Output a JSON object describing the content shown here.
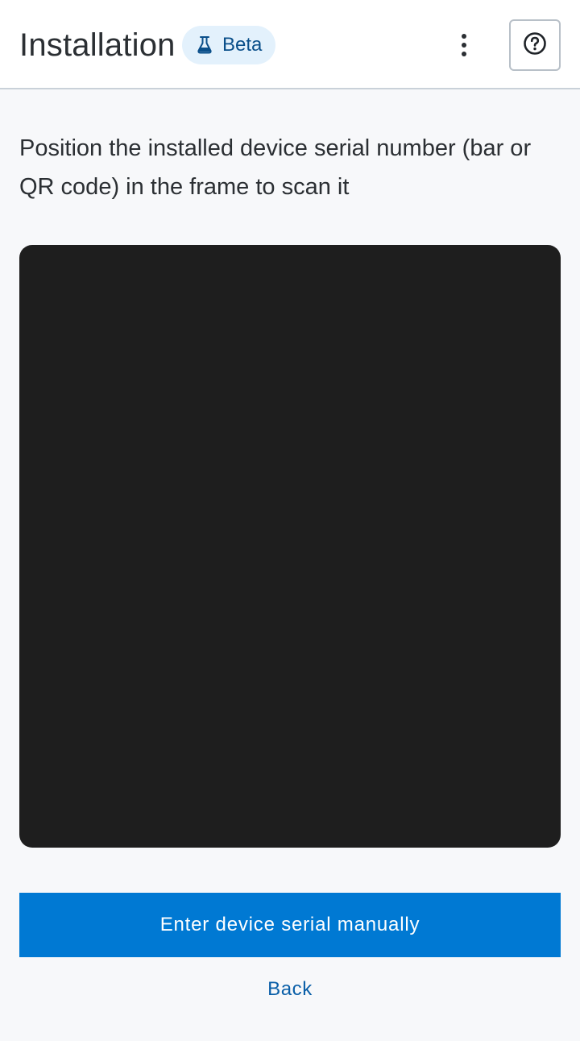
{
  "header": {
    "title": "Installation",
    "badge": {
      "label": "Beta",
      "icon": "flask-icon"
    },
    "more_icon": "vertical-dots-icon",
    "help_icon": "question-circle-icon"
  },
  "main": {
    "instructions": "Position the installed device serial number (bar or QR code) in the frame to scan it"
  },
  "actions": {
    "manual_label": "Enter device serial manually",
    "back_label": "Back"
  },
  "colors": {
    "primary": "#0079d3",
    "badge_bg": "#e3f1fc",
    "badge_text": "#0a4f8a",
    "scanner_bg": "#1e1e1e",
    "link": "#0a5fa8"
  }
}
